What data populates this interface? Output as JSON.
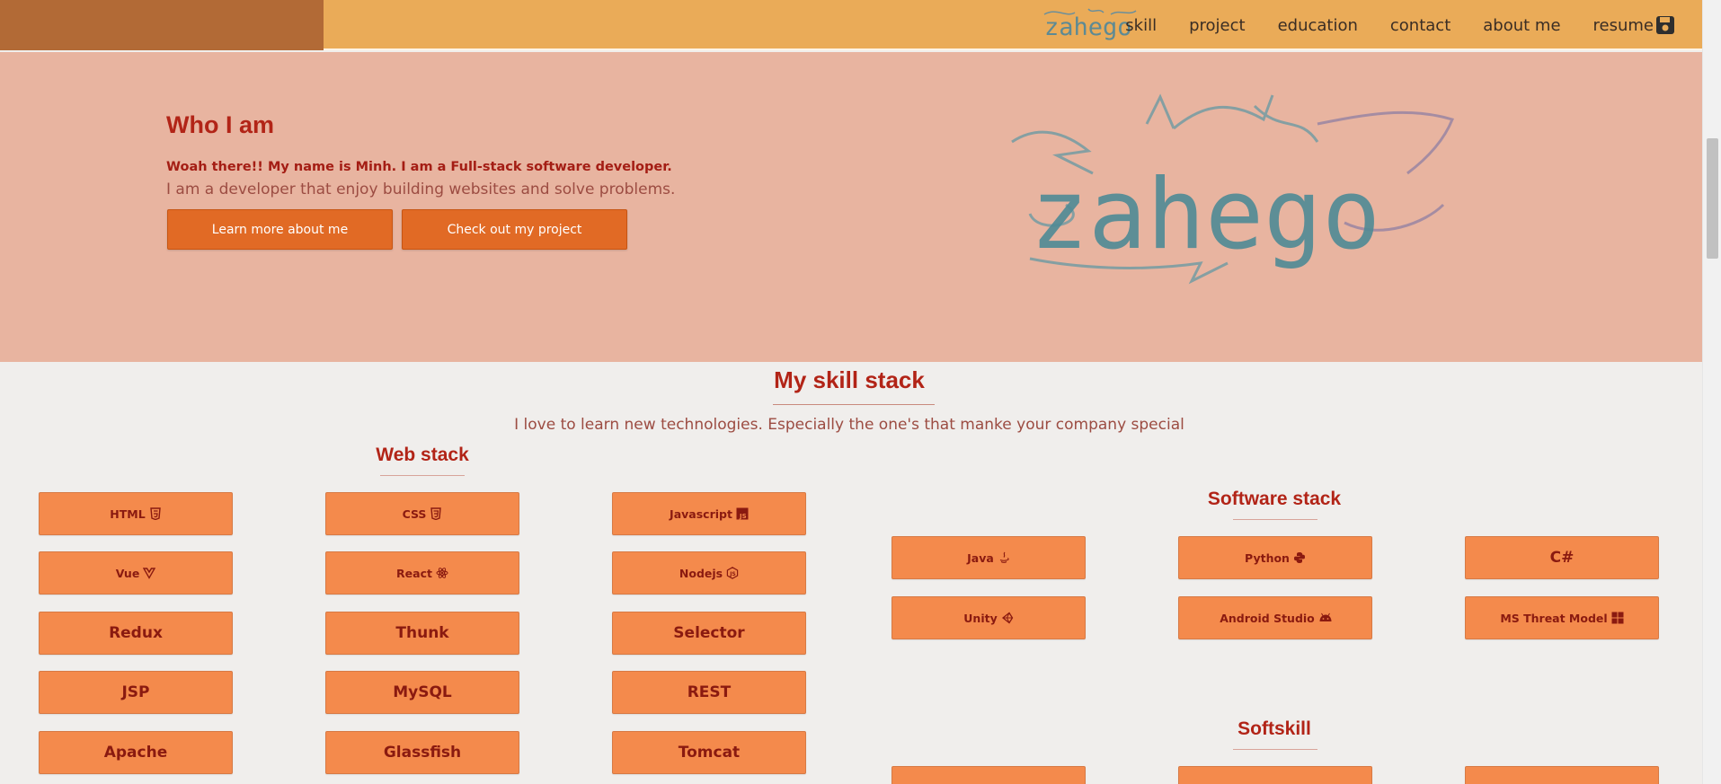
{
  "nav": {
    "logo_text": "zahego",
    "links": [
      "skill",
      "project",
      "education",
      "contact",
      "about me",
      "resume"
    ],
    "resume_icon": "save-icon"
  },
  "hero": {
    "title": "Who I am",
    "intro": "Woah there!! My name is Minh. I am a Full-stack software developer.",
    "description": "I am a developer that enjoy building websites and solve problems.",
    "learn_button": "Learn more about me",
    "project_button": "Check out my project",
    "logo_text": "zahego"
  },
  "skills": {
    "title": "My skill stack",
    "subtitle": "I love to learn new technologies. Especially the one's that manke your company special",
    "web_stack": {
      "title": "Web stack",
      "items": [
        {
          "label": "HTML",
          "icon": "html5-icon"
        },
        {
          "label": "CSS",
          "icon": "css3-icon"
        },
        {
          "label": "Javascript",
          "icon": "js-icon"
        },
        {
          "label": "Vue",
          "icon": "vue-icon"
        },
        {
          "label": "React",
          "icon": "react-icon"
        },
        {
          "label": "Nodejs",
          "icon": "nodejs-icon"
        },
        {
          "label": "Redux"
        },
        {
          "label": "Thunk"
        },
        {
          "label": "Selector"
        },
        {
          "label": "JSP"
        },
        {
          "label": "MySQL"
        },
        {
          "label": "REST"
        },
        {
          "label": "Apache"
        },
        {
          "label": "Glassfish"
        },
        {
          "label": "Tomcat"
        }
      ]
    },
    "software_stack": {
      "title": "Software stack",
      "items": [
        {
          "label": "Java",
          "icon": "java-icon"
        },
        {
          "label": "Python",
          "icon": "python-icon"
        },
        {
          "label": "C#"
        },
        {
          "label": "Unity",
          "icon": "unity-icon"
        },
        {
          "label": "Android Studio",
          "icon": "android-icon"
        },
        {
          "label": "MS Threat Model",
          "icon": "windows-icon"
        }
      ]
    },
    "softskill": {
      "title": "Softskill"
    }
  },
  "colors": {
    "nav_bg": "#eaab58",
    "nav_left": "#b26a36",
    "hero_bg": "#e8b4a0",
    "accent_red": "#b22417",
    "button_orange": "#e16a25",
    "skill_button": "#f48a4c",
    "page_bg": "#f0eeec"
  }
}
